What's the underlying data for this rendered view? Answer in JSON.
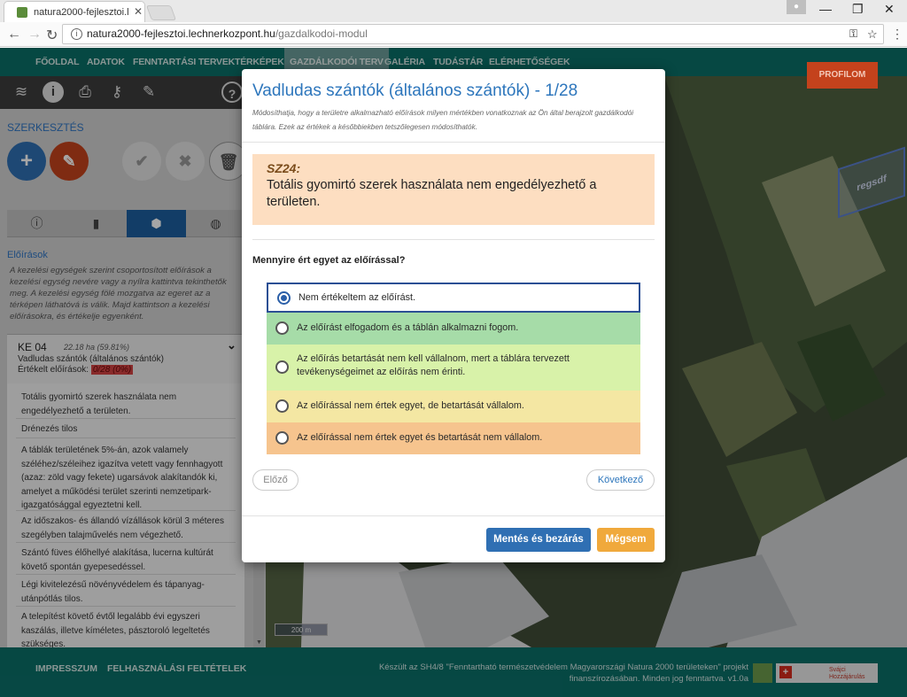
{
  "browser": {
    "tab_title": "natura2000-fejlesztoi.lec",
    "url_host": "natura2000-fejlesztoi.lechnerkozpont.hu",
    "url_path": "/gazdalkodoi-modul"
  },
  "nav": {
    "items": [
      {
        "label": "FŐOLDAL"
      },
      {
        "label": "ADATOK"
      },
      {
        "label": "FENNTARTÁSI TERVEK"
      },
      {
        "label": "TÉRKÉPEK"
      },
      {
        "label": "GAZDÁLKODÓI TERV"
      },
      {
        "label": "GALÉRIA"
      },
      {
        "label": "TUDÁSTÁR"
      },
      {
        "label": "ELÉRHETŐSÉGEK"
      }
    ],
    "active_index": 4,
    "profile_label": "PROFILOM"
  },
  "toolbar_icons": [
    "layers-icon",
    "info-icon",
    "print-icon",
    "key-icon",
    "pencil-icon",
    "help-icon"
  ],
  "left_panel": {
    "edit_label": "SZERKESZTÉS",
    "section_title": "Előírások",
    "section_desc": "A kezelési egységek szerint csoportosított előírások a kezelési egység nevére vagy a nyílra kattintva tekinthetők meg. A kezelési egység fölé mozgatva az egeret az a térképen láthatóvá is válik. Majd kattintson a kezelési előírásokra, és értékelje egyenként.",
    "unit": {
      "id": "KE 04",
      "area": "22.18 ha (59.81%)",
      "name": "Vadludas szántók (általános szántók)",
      "evaluated_label": "Értékelt előírások:",
      "evaluated_value": "0/28 (0%)"
    },
    "rules": [
      "Totális gyomirtó szerek használata nem engedélyezhető a területen.",
      "Drénezés tilos",
      "A táblák területének 5%-án, azok valamely széléhez/széleihez igazítva vetett vagy fennhagyott (azaz: zöld vagy fekete) ugarsávok alakítandók ki, amelyet a működési terület szerinti nemzetipark-igazgatósággal egyeztetni kell.",
      "Az időszakos- és állandó vízállások körül 3 méteres szegélyben talajművelés nem végezhető.",
      "Szántó füves élőhellyé alakítása, lucerna kultúrát követő spontán gyepesedéssel.",
      "Légi kivitelezésű növényvédelem és tápanyag-utánpótlás tilos.",
      "A telepítést követő évtől legalább évi egyszeri kaszálás, illetve kíméletes, pásztoroló legeltetés szükséges."
    ]
  },
  "map": {
    "parcel_label": "regsdf",
    "scale_label": "200 m"
  },
  "modal": {
    "title": "Vadludas szántók (általános szántók) - 1/28",
    "description": "Módosíthatja, hogy a területre alkalmazható előírások milyen mértékben vonatkoznak az Ön által berajzolt gazdálkodói táblára. Ezek az értékek a későbbiekben tetszőlegesen módosíthatók.",
    "rule_code": "SZ24:",
    "rule_text": "Totális gyomirtó szerek használata nem engedélyezhető a területen.",
    "question": "Mennyire ért egyet az előírással?",
    "options": [
      {
        "label": "Nem értékeltem az előírást.",
        "color": "#ffffff",
        "selected": true
      },
      {
        "label": "Az előírást elfogadom és a táblán alkalmazni fogom.",
        "color": "#a6dca8",
        "selected": false
      },
      {
        "label": "Az előírás betartását nem kell vállalnom, mert a táblára tervezett tevékenységeimet az előírás nem érinti.",
        "color": "#d8f2a9",
        "selected": false
      },
      {
        "label": "Az előírással nem értek egyet, de betartását vállalom.",
        "color": "#f4e7a3",
        "selected": false
      },
      {
        "label": "Az előírással nem értek egyet és betartását nem vállalom.",
        "color": "#f6c48e",
        "selected": false
      }
    ],
    "prev_label": "Előző",
    "next_label": "Következő",
    "save_label": "Mentés és bezárás",
    "cancel_label": "Mégsem"
  },
  "footer": {
    "links": [
      "IMPRESSZUM",
      "FELHASZNÁLÁSI FELTÉTELEK"
    ],
    "credit": "Készült az SH4/8 \"Fenntartható természetvédelem Magyarországi Natura 2000 területeken\" projekt finanszírozásában. Minden jog fenntartva. v1.0a",
    "logo_text": "Svájci Hozzájárulás"
  }
}
